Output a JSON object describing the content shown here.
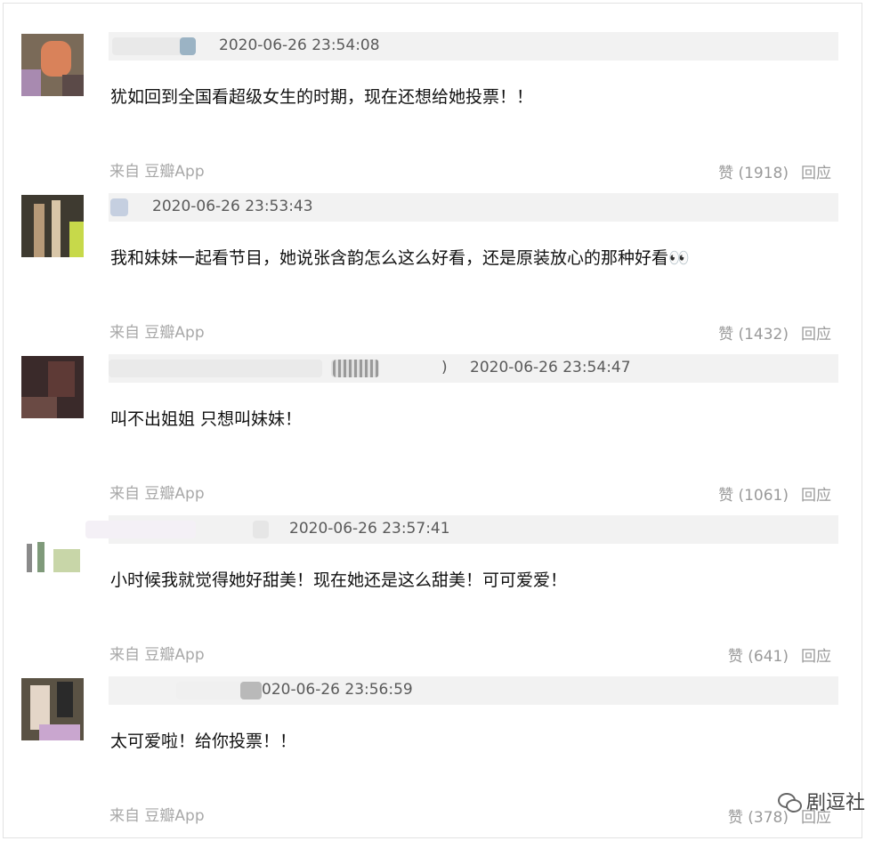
{
  "comments": [
    {
      "timestamp": "2020-06-26 23:54:08",
      "text": "犹如回到全国看超级女生的时期，现在还想给她投票！！",
      "source": "来自 豆瓣App",
      "likes": "赞 (1918)",
      "reply": "回应"
    },
    {
      "timestamp": "2020-06-26 23:53:43",
      "text": "我和妹妹一起看节目，她说张含韵怎么这么好看，还是原装放心的那种好看👀",
      "source": "来自 豆瓣App",
      "likes": "赞 (1432)",
      "reply": "回应"
    },
    {
      "timestamp": "2020-06-26 23:54:47",
      "prefix": ")",
      "text": "叫不出姐姐 只想叫妹妹！",
      "source": "来自 豆瓣App",
      "likes": "赞 (1061)",
      "reply": "回应"
    },
    {
      "timestamp": "2020-06-26 23:57:41",
      "text": "小时候我就觉得她好甜美！现在她还是这么甜美！可可爱爱！",
      "source": "来自 豆瓣App",
      "likes": "赞 (641)",
      "reply": "回应"
    },
    {
      "timestamp": "020-06-26 23:56:59",
      "text": "太可爱啦！给你投票！！",
      "source": "来自 豆瓣App",
      "likes": "赞 (378)",
      "reply": "回应"
    }
  ],
  "watermark": "剧逗社"
}
